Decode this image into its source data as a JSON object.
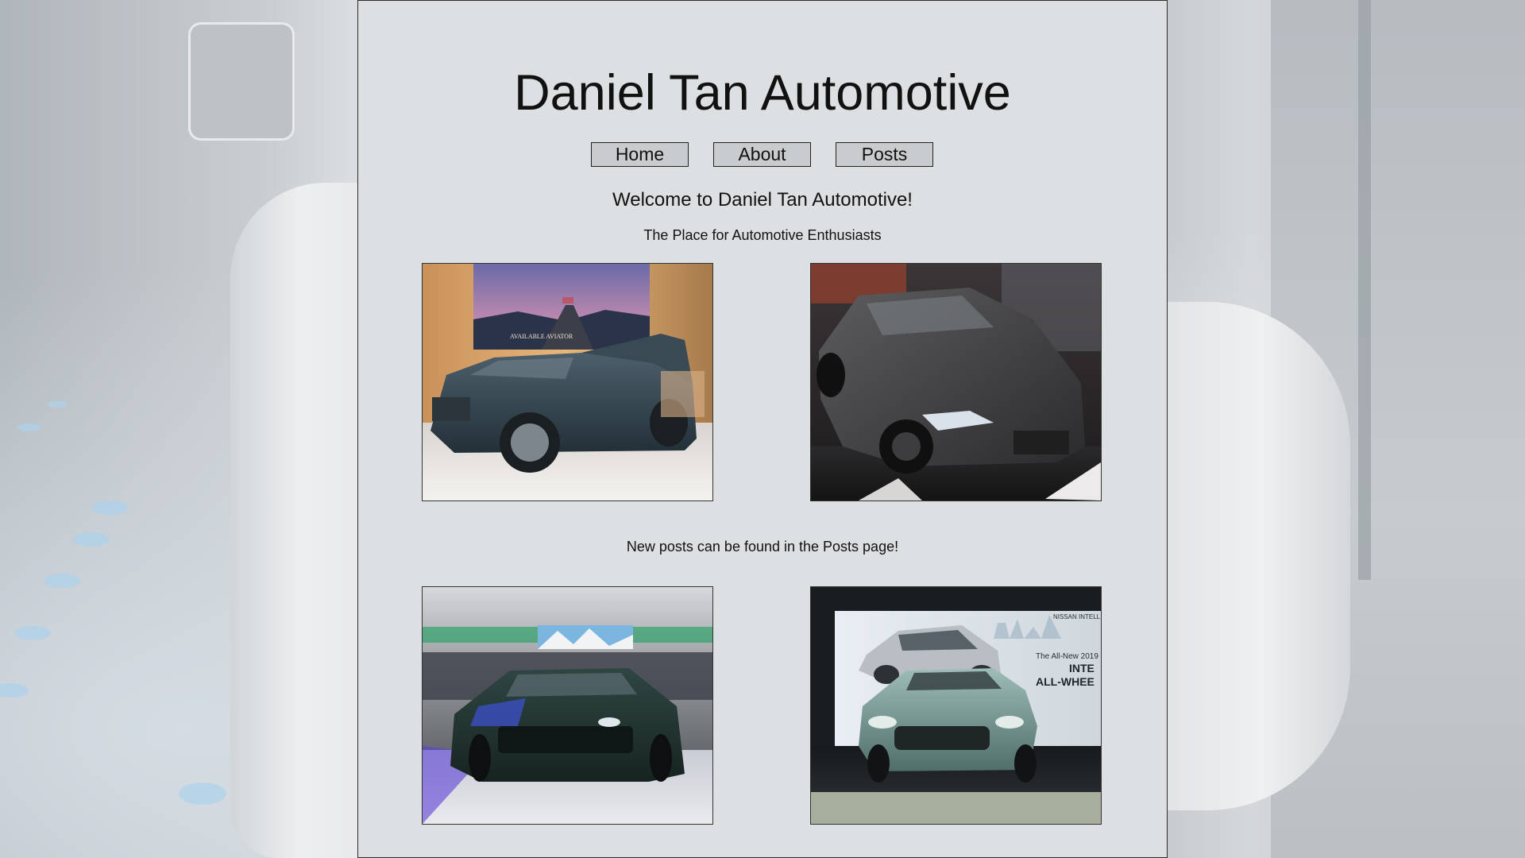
{
  "site": {
    "title": "Daniel Tan Automotive"
  },
  "nav": {
    "items": [
      {
        "label": "Home"
      },
      {
        "label": "About"
      },
      {
        "label": "Posts"
      }
    ]
  },
  "main": {
    "welcome": "Welcome to Daniel Tan Automotive!",
    "tagline": "The Place for Automotive Enthusiasts",
    "posts_note": "New posts can be found in the Posts page!"
  },
  "photos": {
    "aviator_screen_text": "AVAILABLE AVIATOR",
    "nissan_banner_brand": "NISSAN INTELL",
    "nissan_banner_line1": "The All-New 2019",
    "nissan_banner_line2": "INTE",
    "nissan_banner_line3": "ALL-WHEE"
  }
}
